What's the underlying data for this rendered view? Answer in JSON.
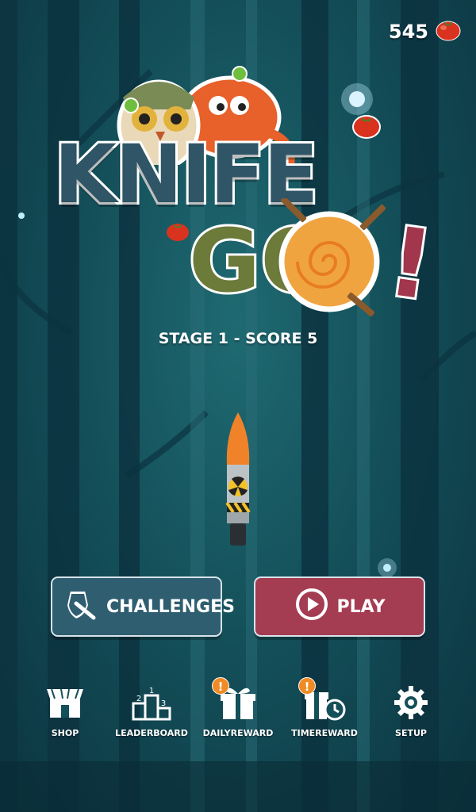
{
  "hud": {
    "coins": "545",
    "currency_icon": "tomato-icon"
  },
  "logo": {
    "word_knife": "KNIFE",
    "word_go": "GO",
    "word_bang": "!",
    "colors": {
      "knife": "#2f5566",
      "go": "#6c7a3a",
      "bang": "#a1364d"
    }
  },
  "stage": {
    "text": "STAGE 1 - SCORE 5"
  },
  "buttons": {
    "challenges": {
      "label": "CHALLENGES",
      "icon": "shield-knife-icon",
      "color": "#2f5e70"
    },
    "play": {
      "label": "PLAY",
      "icon": "play-icon",
      "color": "#a43c52"
    }
  },
  "nav": [
    {
      "label": "SHOP",
      "icon": "shop-icon",
      "badge": ""
    },
    {
      "label": "LEADERBOARD",
      "icon": "podium-icon",
      "badge": ""
    },
    {
      "label": "DAILYREWARD",
      "icon": "gift-icon",
      "badge": "!"
    },
    {
      "label": "TIMEREWARD",
      "icon": "timed-gift-icon",
      "badge": "!"
    },
    {
      "label": "SETUP",
      "icon": "gear-icon",
      "badge": ""
    }
  ]
}
